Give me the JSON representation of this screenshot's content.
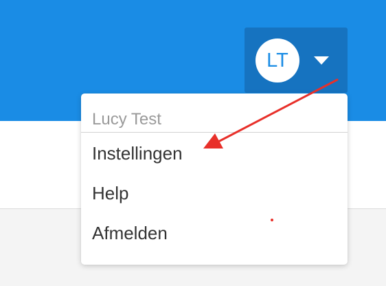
{
  "header": {
    "user_initials": "LT"
  },
  "user_menu": {
    "user_name": "Lucy Test",
    "items": [
      {
        "label": "Instellingen"
      },
      {
        "label": "Help"
      },
      {
        "label": "Afmelden"
      }
    ]
  },
  "colors": {
    "topbar": "#1a8ce5",
    "user_button": "#1673c0",
    "annotation_arrow": "#e8302a"
  },
  "icons": {
    "caret": "chevron-down-icon",
    "annotation": "arrow-annotation-icon"
  }
}
